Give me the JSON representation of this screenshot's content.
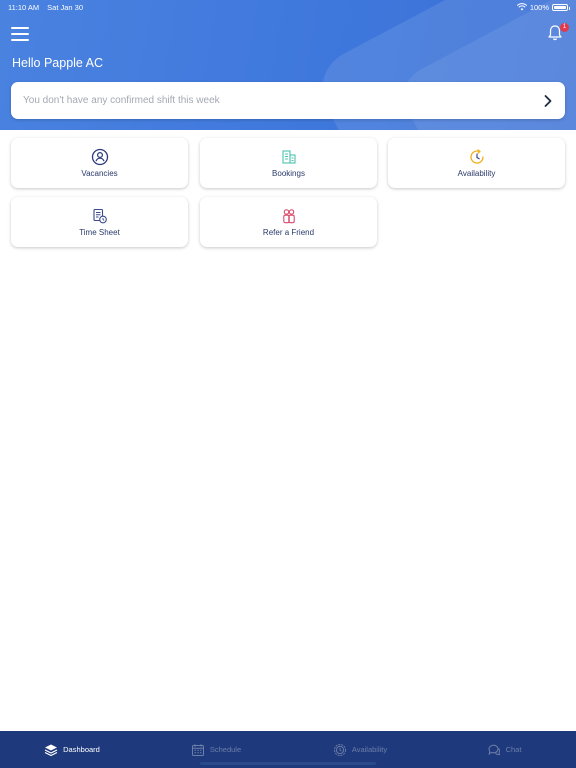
{
  "status_bar": {
    "time": "11:10 AM",
    "date": "Sat Jan 30",
    "battery": "100%"
  },
  "header": {
    "greeting": "Hello Papple AC",
    "notification_count": "1"
  },
  "shift_card": {
    "message": "You don't have any confirmed shift this week"
  },
  "tiles": [
    {
      "label": "Vacancies",
      "icon": "person-circle-icon",
      "color": "#2a3a7a"
    },
    {
      "label": "Bookings",
      "icon": "building-icon",
      "color": "#4cc4b0"
    },
    {
      "label": "Availability",
      "icon": "clock-refresh-icon",
      "color": "#f0b020"
    },
    {
      "label": "Time Sheet",
      "icon": "timesheet-icon",
      "color": "#3a4a8a"
    },
    {
      "label": "Refer a Friend",
      "icon": "people-icon",
      "color": "#d84a6a"
    }
  ],
  "tabbar": {
    "items": [
      {
        "label": "Dashboard",
        "icon": "layers-icon",
        "active": true
      },
      {
        "label": "Schedule",
        "icon": "calendar-icon",
        "active": false
      },
      {
        "label": "Availability",
        "icon": "gear-clock-icon",
        "active": false
      },
      {
        "label": "Chat",
        "icon": "chat-icon",
        "active": false
      }
    ]
  },
  "colors": {
    "header_blue": "#4a82e0",
    "tabbar_navy": "#1f3a7c",
    "badge_red": "#e4384b"
  }
}
